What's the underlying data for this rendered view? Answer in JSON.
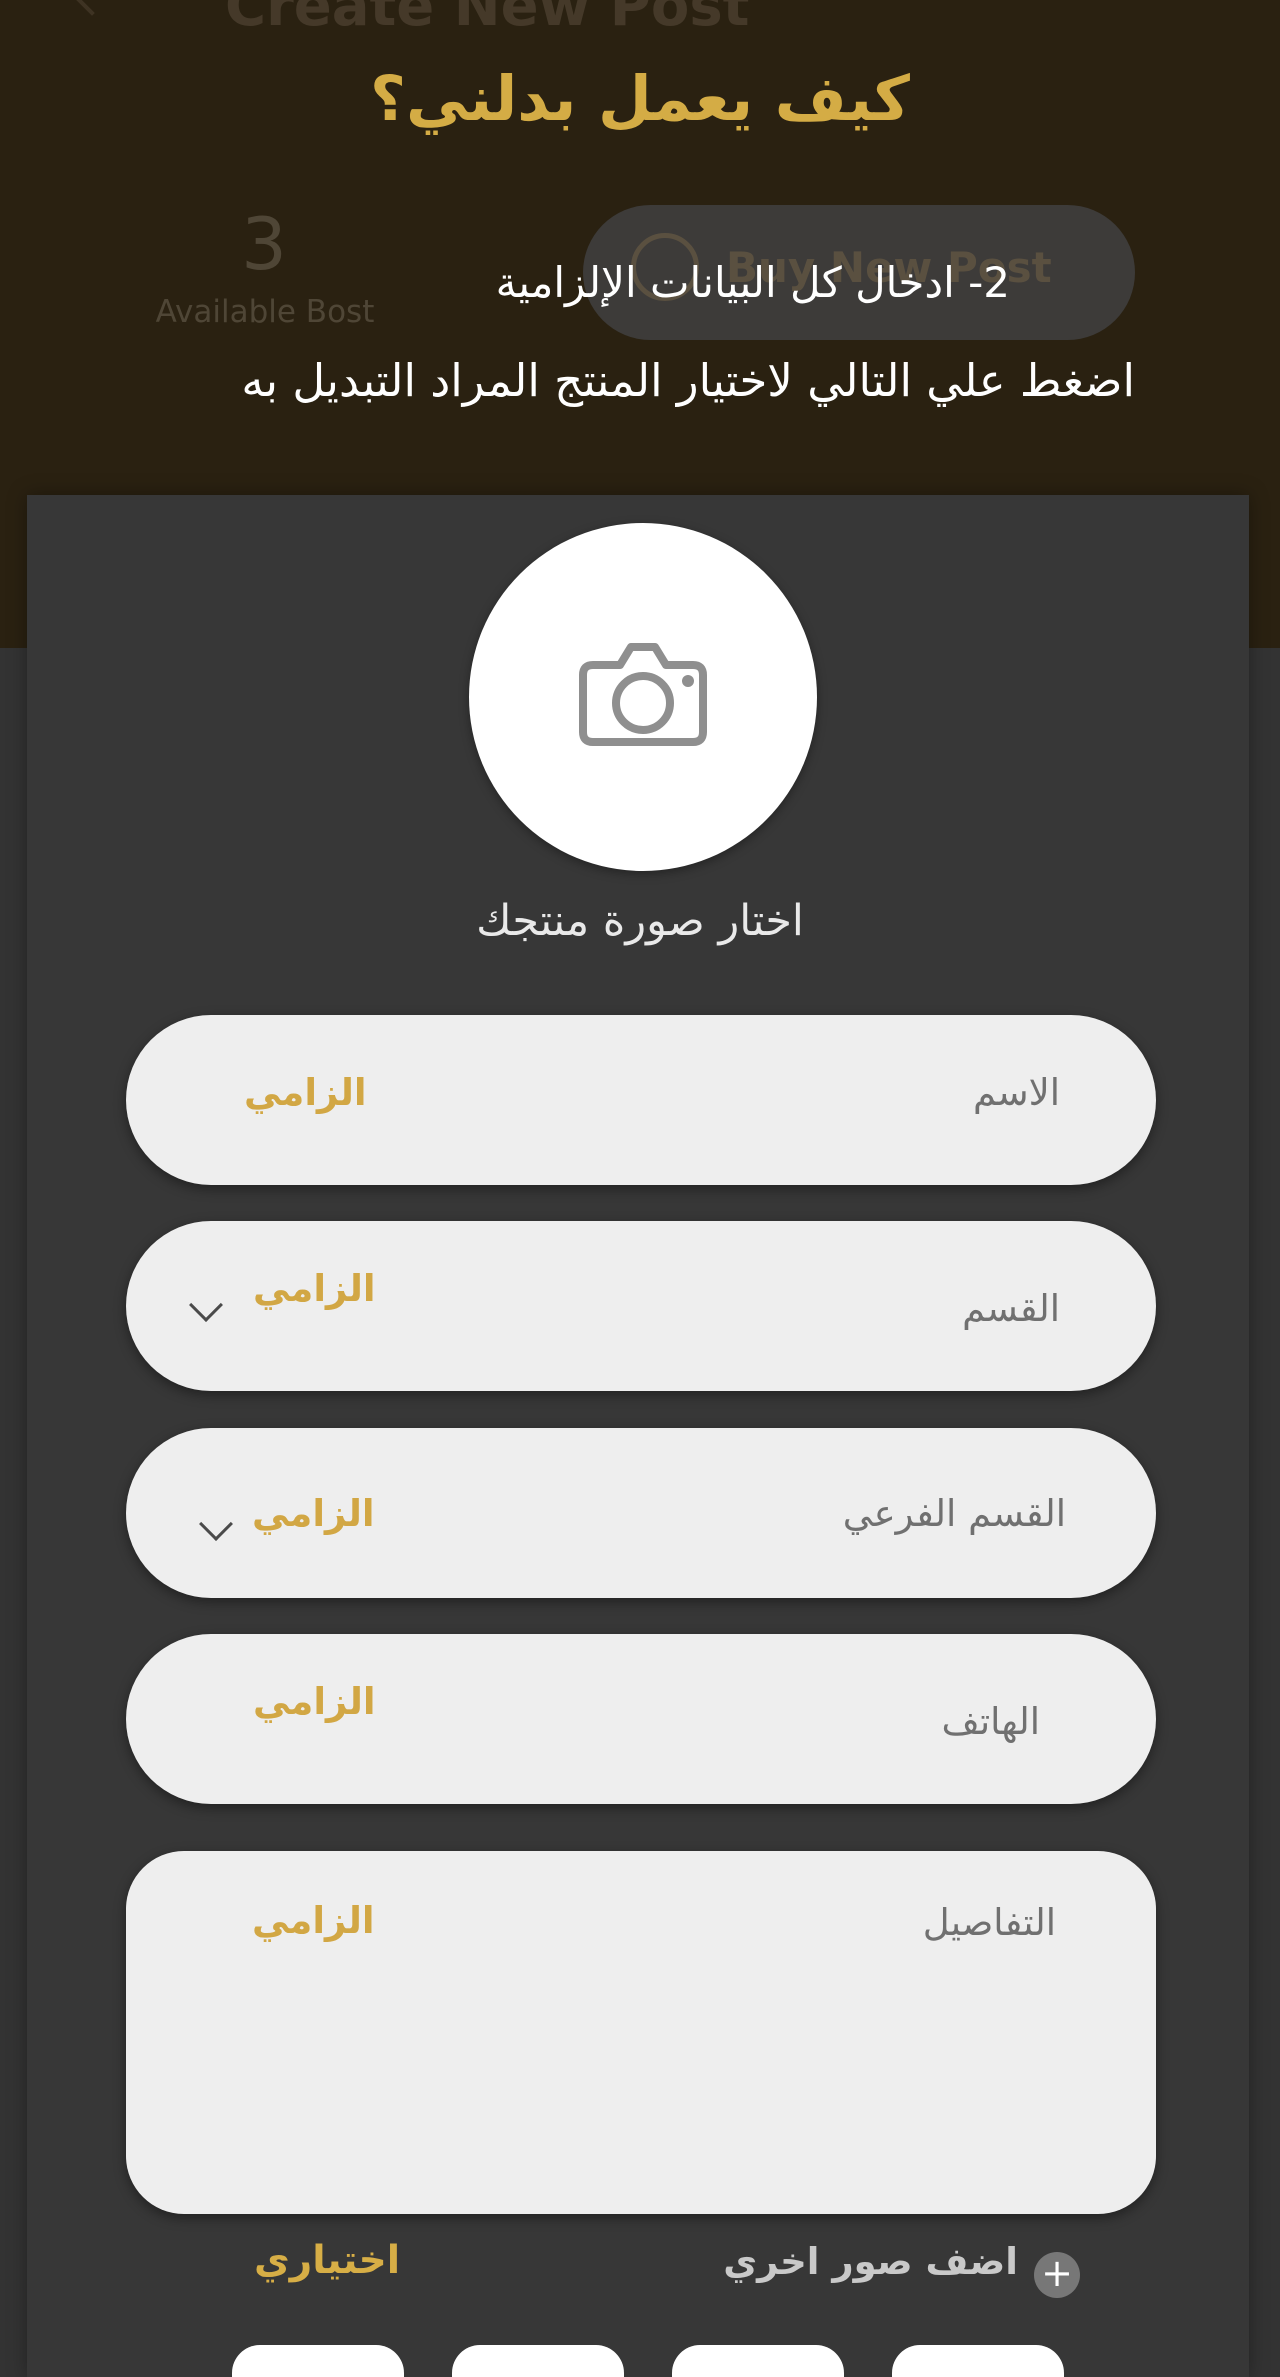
{
  "background": {
    "page_title": "Create New Post",
    "available_count": "3",
    "available_label": "Available Bost",
    "buy_button_label": "Buy New Post"
  },
  "help": {
    "title": "كيف يعمل بدلني؟",
    "step": "2-  ادخال كل البيانات الإلزامية",
    "hint": "اضغط علي التالي لاختيار المنتج المراد التبديل به"
  },
  "form": {
    "photo_label": "اختار صورة منتجك",
    "fields": [
      {
        "label": "الاسم",
        "badge": "الزامي",
        "dropdown": false
      },
      {
        "label": "القسم",
        "badge": "الزامي",
        "dropdown": true
      },
      {
        "label": "القسم الفرعي",
        "badge": "الزامي",
        "dropdown": true
      },
      {
        "label": "الهاتف",
        "badge": "الزامي",
        "dropdown": false
      },
      {
        "label": "التفاصيل",
        "badge": "الزامي",
        "dropdown": false
      }
    ],
    "add_photos_label": "اضف صور اخري",
    "add_photos_icon": "plus-circle-icon",
    "optional_label": "اختياري"
  },
  "colors": {
    "accent": "#D4AC45",
    "overlay": "#2A2111",
    "field": "#EEEEEE",
    "card": "#373737"
  }
}
